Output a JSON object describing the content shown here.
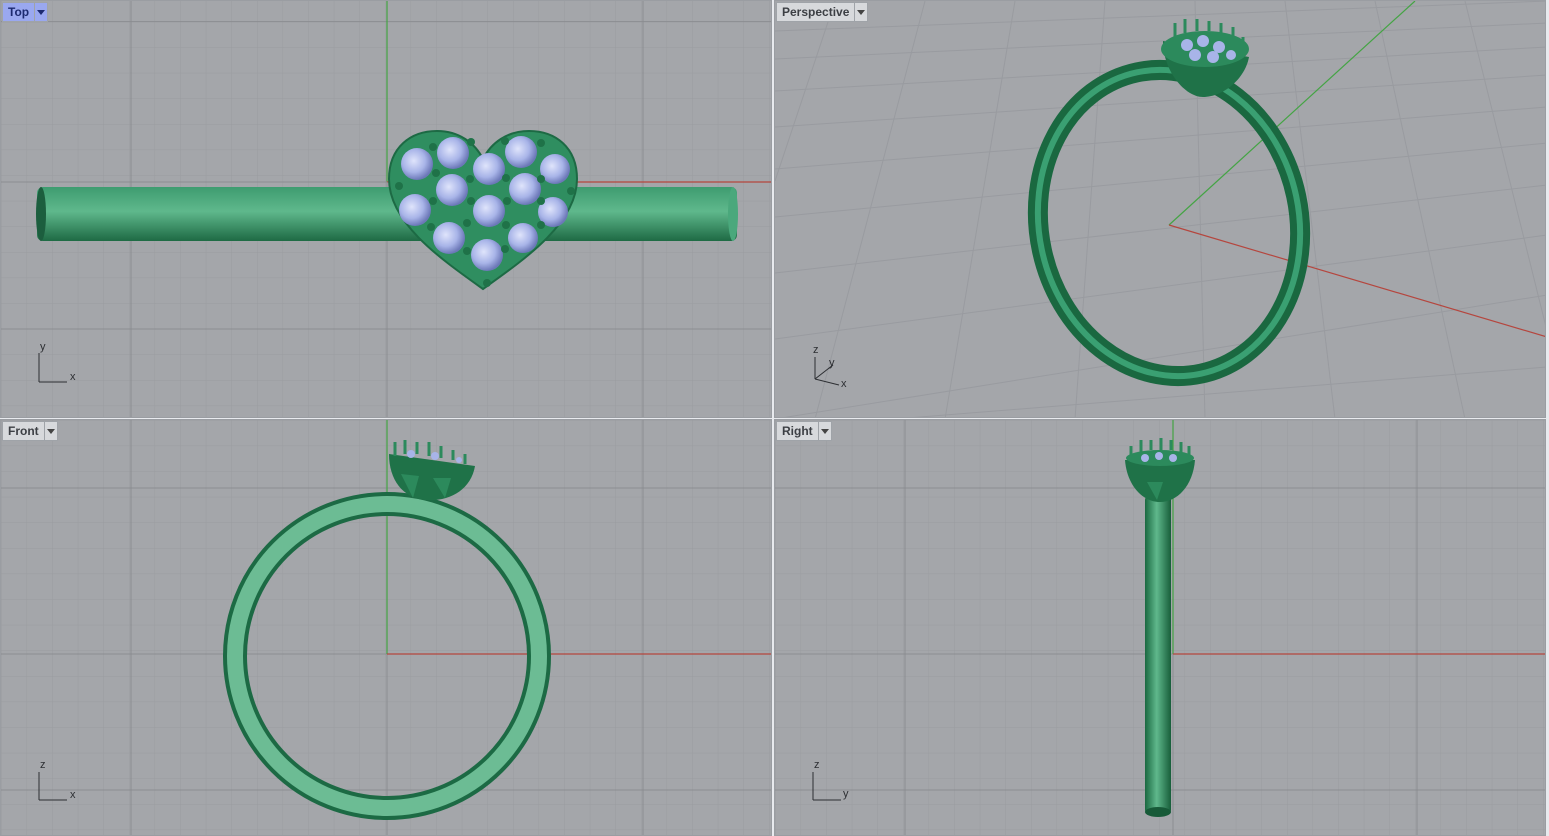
{
  "viewports": [
    {
      "key": "top",
      "title": "Top",
      "active": true,
      "axes": [
        "y",
        "x"
      ]
    },
    {
      "key": "perspective",
      "title": "Perspective",
      "active": false,
      "axes": [
        "z",
        "y",
        "x"
      ]
    },
    {
      "key": "front",
      "title": "Front",
      "active": false,
      "axes": [
        "z",
        "x"
      ]
    },
    {
      "key": "right",
      "title": "Right",
      "active": false,
      "axes": [
        "z",
        "y"
      ]
    }
  ],
  "colors": {
    "viewport_bg": "#a4a6aa",
    "grid_minor": "#9a9ca0",
    "grid_major": "#8b8d91",
    "axis_x": "#b5463e",
    "axis_y": "#44a444",
    "metal": "#2e8a5c",
    "metal_light": "#6cbc94",
    "gem": "#a8b4e8",
    "tab_selected": "#9aa8f0"
  },
  "icons": {
    "viewport_menu": "chevron-down-icon",
    "axis_widget": "axis-triad-icon"
  }
}
